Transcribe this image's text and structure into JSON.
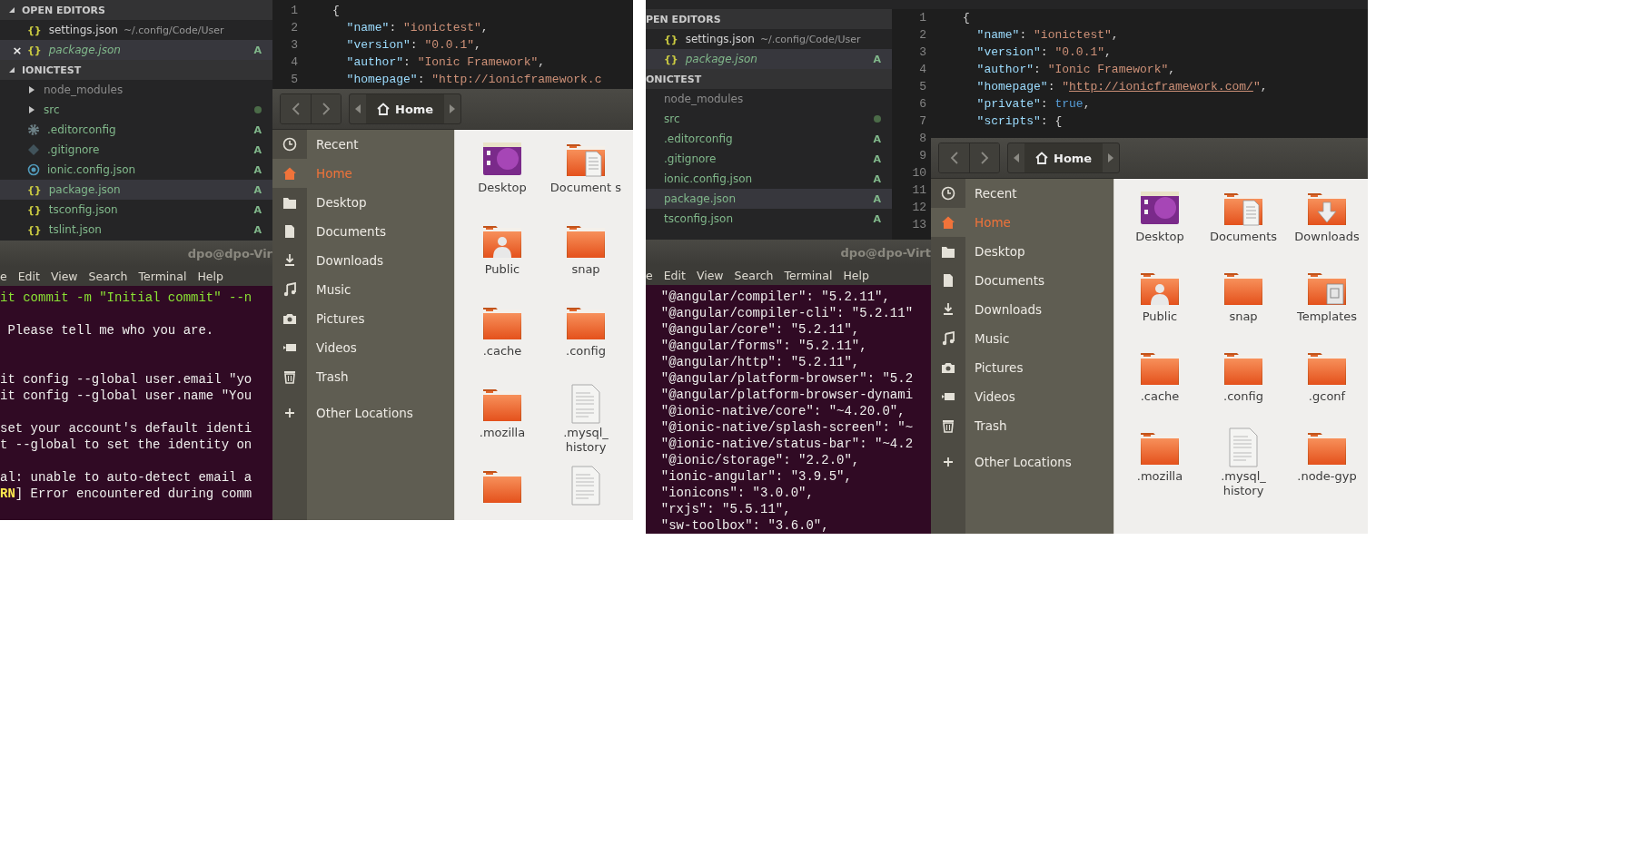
{
  "screenshots": [
    {
      "explorer": {
        "sections": [
          {
            "title": "OPEN EDITORS",
            "expanded": true,
            "items": [
              {
                "icon": "{}",
                "name": "settings.json",
                "path": "~/.config/Code/User",
                "color": "#d4d4d4",
                "selected": false,
                "italic": false
              },
              {
                "close": "×",
                "icon": "{}",
                "name": "package.json",
                "color": "#81b88b",
                "badge": "A",
                "selected": true,
                "italic": true
              }
            ]
          },
          {
            "title": "IONICTEST",
            "expanded": true,
            "items": [
              {
                "kind": "folder",
                "name": "node_modules",
                "color": "#8c8c8c",
                "selected": false,
                "italic": false
              },
              {
                "kind": "folder",
                "name": "src",
                "color": "#81b88b",
                "dot": true,
                "selected": false,
                "italic": false
              },
              {
                "kind": "gear",
                "name": ".editorconfig",
                "color": "#81b88b",
                "badge": "A",
                "selected": false,
                "italic": false
              },
              {
                "kind": "diamond",
                "name": ".gitignore",
                "color": "#81b88b",
                "badge": "A",
                "selected": false,
                "italic": false
              },
              {
                "kind": "ring",
                "name": "ionic.config.json",
                "color": "#81b88b",
                "badge": "A",
                "selected": false,
                "italic": false
              },
              {
                "icon": "{}",
                "name": "package.json",
                "color": "#81b88b",
                "badge": "A",
                "selected": true,
                "italic": false
              },
              {
                "icon": "{}",
                "name": "tsconfig.json",
                "color": "#81b88b",
                "badge": "A",
                "selected": false,
                "italic": false
              },
              {
                "icon": "{}",
                "name": "tslint.json",
                "color": "#81b88b",
                "badge": "A",
                "selected": false,
                "italic": false
              }
            ]
          }
        ]
      },
      "editor": {
        "lines": [
          {
            "n": "1",
            "segments": [
              {
                "kind": "punc",
                "text": "{"
              }
            ]
          },
          {
            "n": "2",
            "segments": [
              {
                "kind": "key",
                "text": "  \"name\""
              },
              {
                "kind": "punc",
                "text": ": "
              },
              {
                "kind": "str",
                "text": "\"ionictest\""
              },
              {
                "kind": "punc",
                "text": ","
              }
            ]
          },
          {
            "n": "3",
            "segments": [
              {
                "kind": "key",
                "text": "  \"version\""
              },
              {
                "kind": "punc",
                "text": ": "
              },
              {
                "kind": "str",
                "text": "\"0.0.1\""
              },
              {
                "kind": "punc",
                "text": ","
              }
            ]
          },
          {
            "n": "4",
            "segments": [
              {
                "kind": "key",
                "text": "  \"author\""
              },
              {
                "kind": "punc",
                "text": ": "
              },
              {
                "kind": "str",
                "text": "\"Ionic Framework\""
              },
              {
                "kind": "punc",
                "text": ","
              }
            ]
          },
          {
            "n": "5",
            "segments": [
              {
                "kind": "key",
                "text": "  \"homepage\""
              },
              {
                "kind": "punc",
                "text": ": "
              },
              {
                "kind": "str",
                "text": "\"http://ionicframework.c"
              }
            ]
          }
        ]
      },
      "terminal": {
        "title": "dpo@dpo-Vir",
        "menu": [
          "e",
          "Edit",
          "View",
          "Search",
          "Terminal",
          "Help"
        ],
        "lines": [
          {
            "kind": "text",
            "segments": [
              {
                "kind": "cmd",
                "text": "it commit -m \"Initial commit\" --n"
              }
            ]
          },
          {
            "kind": "blank"
          },
          {
            "kind": "text",
            "segments": [
              {
                "kind": "plain",
                "text": " Please tell me who you are."
              }
            ]
          },
          {
            "kind": "blank"
          },
          {
            "kind": "blank"
          },
          {
            "kind": "text",
            "segments": [
              {
                "kind": "plain",
                "text": "it config --global user.email \"yo"
              }
            ]
          },
          {
            "kind": "text",
            "segments": [
              {
                "kind": "plain",
                "text": "it config --global user.name \"You"
              }
            ]
          },
          {
            "kind": "blank"
          },
          {
            "kind": "text",
            "segments": [
              {
                "kind": "plain",
                "text": "set your account's default identi"
              }
            ]
          },
          {
            "kind": "text",
            "segments": [
              {
                "kind": "plain",
                "text": "t --global to set the identity on"
              }
            ]
          },
          {
            "kind": "blank"
          },
          {
            "kind": "text",
            "segments": [
              {
                "kind": "plain",
                "text": "al: unable to auto-detect email a"
              }
            ]
          },
          {
            "kind": "text",
            "segments": [
              {
                "kind": "warn",
                "text": "RN"
              },
              {
                "kind": "plain",
                "text": "] Error encountered during comm"
              }
            ]
          }
        ]
      },
      "files": {
        "location": "Home",
        "places": [
          {
            "kind": "recent",
            "label": "Recent",
            "selected": false
          },
          {
            "kind": "home",
            "label": "Home",
            "selected": true
          },
          {
            "kind": "desktop",
            "label": "Desktop",
            "selected": false
          },
          {
            "kind": "documents",
            "label": "Documents",
            "selected": false
          },
          {
            "kind": "downloads",
            "label": "Downloads",
            "selected": false
          },
          {
            "kind": "music",
            "label": "Music",
            "selected": false
          },
          {
            "kind": "pictures",
            "label": "Pictures",
            "selected": false
          },
          {
            "kind": "videos",
            "label": "Videos",
            "selected": false
          },
          {
            "kind": "trash",
            "label": "Trash",
            "selected": false
          },
          {
            "kind": "other",
            "label": "Other Locations",
            "selected": false
          }
        ],
        "items": [
          {
            "kind": "desktop",
            "label": "Desktop"
          },
          {
            "kind": "documents",
            "label": "Document s"
          },
          {
            "kind": "public",
            "label": "Public"
          },
          {
            "kind": "folder",
            "label": "snap"
          },
          {
            "kind": "folder",
            "label": ".cache"
          },
          {
            "kind": "folder",
            "label": ".config"
          },
          {
            "kind": "folder",
            "label": ".mozilla"
          },
          {
            "kind": "file",
            "label": ".mysql_ history"
          },
          {
            "kind": "folder"
          },
          {
            "kind": "file"
          }
        ]
      }
    },
    {
      "explorer": {
        "sections": [
          {
            "title": "PEN EDITORS",
            "items": [
              {
                "icon": "{}",
                "name": "settings.json",
                "path": "~/.config/Code/User",
                "color": "#d4d4d4",
                "selected": false,
                "italic": false
              },
              {
                "icon": "{}",
                "name": "package.json",
                "color": "#81b88b",
                "badge": "A",
                "selected": true,
                "italic": true
              }
            ]
          },
          {
            "title": "ONICTEST",
            "items": [
              {
                "name": "node_modules",
                "color": "#8c8c8c",
                "selected": false,
                "italic": false
              },
              {
                "name": "src",
                "color": "#81b88b",
                "dot": true,
                "selected": false,
                "italic": false
              },
              {
                "name": ".editorconfig",
                "color": "#81b88b",
                "badge": "A",
                "selected": false,
                "italic": false
              },
              {
                "name": ".gitignore",
                "color": "#81b88b",
                "badge": "A",
                "selected": false,
                "italic": false
              },
              {
                "name": "ionic.config.json",
                "color": "#81b88b",
                "badge": "A",
                "selected": false,
                "italic": false
              },
              {
                "name": "package.json",
                "color": "#81b88b",
                "badge": "A",
                "selected": true,
                "italic": false
              },
              {
                "name": "tsconfig.json",
                "color": "#81b88b",
                "badge": "A",
                "selected": false,
                "italic": false
              }
            ]
          }
        ]
      },
      "editor": {
        "lines": [
          {
            "n": "1",
            "segments": [
              {
                "kind": "punc",
                "text": "{"
              }
            ]
          },
          {
            "n": "2",
            "segments": [
              {
                "kind": "key",
                "text": "  \"name\""
              },
              {
                "kind": "punc",
                "text": ": "
              },
              {
                "kind": "str",
                "text": "\"ionictest\""
              },
              {
                "kind": "punc",
                "text": ","
              }
            ]
          },
          {
            "n": "3",
            "segments": [
              {
                "kind": "key",
                "text": "  \"version\""
              },
              {
                "kind": "punc",
                "text": ": "
              },
              {
                "kind": "str",
                "text": "\"0.0.1\""
              },
              {
                "kind": "punc",
                "text": ","
              }
            ]
          },
          {
            "n": "4",
            "segments": [
              {
                "kind": "key",
                "text": "  \"author\""
              },
              {
                "kind": "punc",
                "text": ": "
              },
              {
                "kind": "str",
                "text": "\"Ionic Framework\""
              },
              {
                "kind": "punc",
                "text": ","
              }
            ]
          },
          {
            "n": "5",
            "segments": [
              {
                "kind": "key",
                "text": "  \"homepage\""
              },
              {
                "kind": "punc",
                "text": ": "
              },
              {
                "kind": "str",
                "text": "\""
              },
              {
                "kind": "link",
                "text": "http://ionicframework.com/"
              },
              {
                "kind": "str",
                "text": "\""
              },
              {
                "kind": "punc",
                "text": ","
              }
            ]
          },
          {
            "n": "6",
            "segments": [
              {
                "kind": "key",
                "text": "  \"private\""
              },
              {
                "kind": "punc",
                "text": ": "
              },
              {
                "kind": "bool",
                "text": "true"
              },
              {
                "kind": "punc",
                "text": ","
              }
            ]
          },
          {
            "n": "7",
            "segments": [
              {
                "kind": "key",
                "text": "  \"scripts\""
              },
              {
                "kind": "punc",
                "text": ": {"
              }
            ]
          },
          {
            "n": "8"
          },
          {
            "n": "9"
          },
          {
            "n": "10"
          },
          {
            "n": "11"
          },
          {
            "n": "12"
          },
          {
            "n": "13"
          }
        ]
      },
      "terminal": {
        "title": "dpo@dpo-Virt",
        "menu": [
          "e",
          "Edit",
          "View",
          "Search",
          "Terminal",
          "Help"
        ],
        "lines": [
          {
            "kind": "text",
            "segments": [
              {
                "kind": "plain",
                "text": "  \"@angular/compiler\": \"5.2.11\","
              }
            ]
          },
          {
            "kind": "text",
            "segments": [
              {
                "kind": "plain",
                "text": "  \"@angular/compiler-cli\": \"5.2.11\""
              }
            ]
          },
          {
            "kind": "text",
            "segments": [
              {
                "kind": "plain",
                "text": "  \"@angular/core\": \"5.2.11\","
              }
            ]
          },
          {
            "kind": "text",
            "segments": [
              {
                "kind": "plain",
                "text": "  \"@angular/forms\": \"5.2.11\","
              }
            ]
          },
          {
            "kind": "text",
            "segments": [
              {
                "kind": "plain",
                "text": "  \"@angular/http\": \"5.2.11\","
              }
            ]
          },
          {
            "kind": "text",
            "segments": [
              {
                "kind": "plain",
                "text": "  \"@angular/platform-browser\": \"5.2"
              }
            ]
          },
          {
            "kind": "text",
            "segments": [
              {
                "kind": "plain",
                "text": "  \"@angular/platform-browser-dynami"
              }
            ]
          },
          {
            "kind": "text",
            "segments": [
              {
                "kind": "plain",
                "text": "  \"@ionic-native/core\": \"~4.20.0\","
              }
            ]
          },
          {
            "kind": "text",
            "segments": [
              {
                "kind": "plain",
                "text": "  \"@ionic-native/splash-screen\": \"~"
              }
            ]
          },
          {
            "kind": "text",
            "segments": [
              {
                "kind": "plain",
                "text": "  \"@ionic-native/status-bar\": \"~4.2"
              }
            ]
          },
          {
            "kind": "text",
            "segments": [
              {
                "kind": "plain",
                "text": "  \"@ionic/storage\": \"2.2.0\","
              }
            ]
          },
          {
            "kind": "text",
            "segments": [
              {
                "kind": "plain",
                "text": "  \"ionic-angular\": \"3.9.5\","
              }
            ]
          },
          {
            "kind": "text",
            "segments": [
              {
                "kind": "plain",
                "text": "  \"ionicons\": \"3.0.0\","
              }
            ]
          },
          {
            "kind": "text",
            "segments": [
              {
                "kind": "plain",
                "text": "  \"rxjs\": \"5.5.11\","
              }
            ]
          },
          {
            "kind": "text",
            "segments": [
              {
                "kind": "plain",
                "text": "  \"sw-toolbox\": \"3.6.0\","
              }
            ]
          }
        ]
      },
      "files": {
        "location": "Home",
        "places": [
          {
            "kind": "recent",
            "label": "Recent",
            "selected": false
          },
          {
            "kind": "home",
            "label": "Home",
            "selected": true
          },
          {
            "kind": "desktop",
            "label": "Desktop",
            "selected": false
          },
          {
            "kind": "documents",
            "label": "Documents",
            "selected": false
          },
          {
            "kind": "downloads",
            "label": "Downloads",
            "selected": false
          },
          {
            "kind": "music",
            "label": "Music",
            "selected": false
          },
          {
            "kind": "pictures",
            "label": "Pictures",
            "selected": false
          },
          {
            "kind": "videos",
            "label": "Videos",
            "selected": false
          },
          {
            "kind": "trash",
            "label": "Trash",
            "selected": false
          },
          {
            "kind": "other",
            "label": "Other Locations",
            "selected": false
          }
        ],
        "items": [
          {
            "kind": "desktop",
            "label": "Desktop"
          },
          {
            "kind": "documents",
            "label": "Documents"
          },
          {
            "kind": "downloads",
            "label": "Downloads"
          },
          {
            "kind": "public",
            "label": "Public"
          },
          {
            "kind": "folder",
            "label": "snap"
          },
          {
            "kind": "templates",
            "label": "Templates"
          },
          {
            "kind": "folder",
            "label": ".cache"
          },
          {
            "kind": "folder",
            "label": ".config"
          },
          {
            "kind": "folder",
            "label": ".gconf"
          },
          {
            "kind": "folder",
            "label": ".mozilla"
          },
          {
            "kind": "file",
            "label": ".mysql_ history"
          },
          {
            "kind": "folder",
            "label": ".node-gyp"
          }
        ]
      }
    }
  ]
}
